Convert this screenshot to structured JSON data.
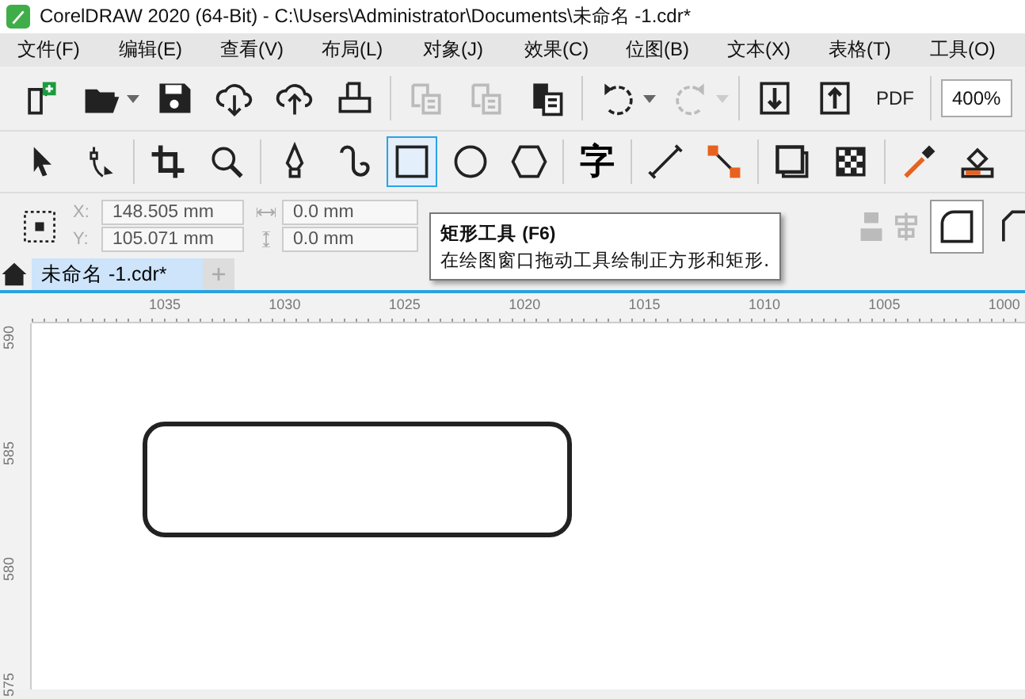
{
  "window": {
    "title": "CorelDRAW 2020 (64-Bit) - C:\\Users\\Administrator\\Documents\\未命名 -1.cdr*"
  },
  "menu": [
    "文件(F)",
    "编辑(E)",
    "查看(V)",
    "布局(L)",
    "对象(J)",
    "效果(C)",
    "位图(B)",
    "文本(X)",
    "表格(T)",
    "工具(O)"
  ],
  "standard_toolbar": {
    "buttons": [
      {
        "kind": "new",
        "disabled": false
      },
      {
        "kind": "open",
        "disabled": false
      },
      {
        "kind": "save",
        "disabled": false
      },
      {
        "kind": "cloud-down",
        "disabled": false
      },
      {
        "kind": "cloud-up",
        "disabled": false
      },
      {
        "kind": "print",
        "disabled": false
      },
      {
        "kind": "sep"
      },
      {
        "kind": "cut",
        "disabled": true
      },
      {
        "kind": "copy",
        "disabled": true
      },
      {
        "kind": "paste",
        "disabled": false
      },
      {
        "kind": "sep"
      },
      {
        "kind": "undo",
        "disabled": false
      },
      {
        "kind": "redo",
        "disabled": true
      },
      {
        "kind": "sep"
      },
      {
        "kind": "import",
        "disabled": false
      },
      {
        "kind": "export",
        "disabled": false
      },
      {
        "kind": "pdf",
        "label": "PDF",
        "disabled": false
      }
    ],
    "zoom": "400%"
  },
  "toolbox": [
    {
      "kind": "pick",
      "selected": false
    },
    {
      "kind": "shape",
      "selected": false
    },
    {
      "kind": "sep"
    },
    {
      "kind": "crop",
      "selected": false
    },
    {
      "kind": "zoom",
      "selected": false
    },
    {
      "kind": "sep"
    },
    {
      "kind": "pen",
      "selected": false
    },
    {
      "kind": "spiral",
      "selected": false
    },
    {
      "kind": "rectangle",
      "selected": true
    },
    {
      "kind": "ellipse",
      "selected": false
    },
    {
      "kind": "polygon",
      "selected": false
    },
    {
      "kind": "sep"
    },
    {
      "kind": "text",
      "label": "字",
      "selected": false
    },
    {
      "kind": "sep"
    },
    {
      "kind": "line",
      "selected": false
    },
    {
      "kind": "connector",
      "selected": false
    },
    {
      "kind": "sep"
    },
    {
      "kind": "shadow",
      "selected": false
    },
    {
      "kind": "transparency",
      "selected": false
    },
    {
      "kind": "sep"
    },
    {
      "kind": "eyedropper",
      "selected": false
    },
    {
      "kind": "fill",
      "selected": false
    }
  ],
  "property_bar": {
    "x_label": "X:",
    "x": "148.505 mm",
    "y_label": "Y:",
    "y": "105.071 mm",
    "width": "0.0 mm",
    "height": "0.0 mm"
  },
  "tooltip": {
    "title": "矩形工具",
    "shortcut": "(F6)",
    "text": "在绘图窗口拖动工具绘制正方形和矩形."
  },
  "document_tabs": [
    {
      "label": "未命名 -1.cdr*",
      "selected": true
    }
  ],
  "horizontal_ruler": [
    "1035",
    "1030",
    "1025",
    "1020",
    "1015",
    "1010",
    "1005",
    "1000"
  ],
  "vertical_ruler": [
    "590",
    "585",
    "580",
    "575"
  ]
}
